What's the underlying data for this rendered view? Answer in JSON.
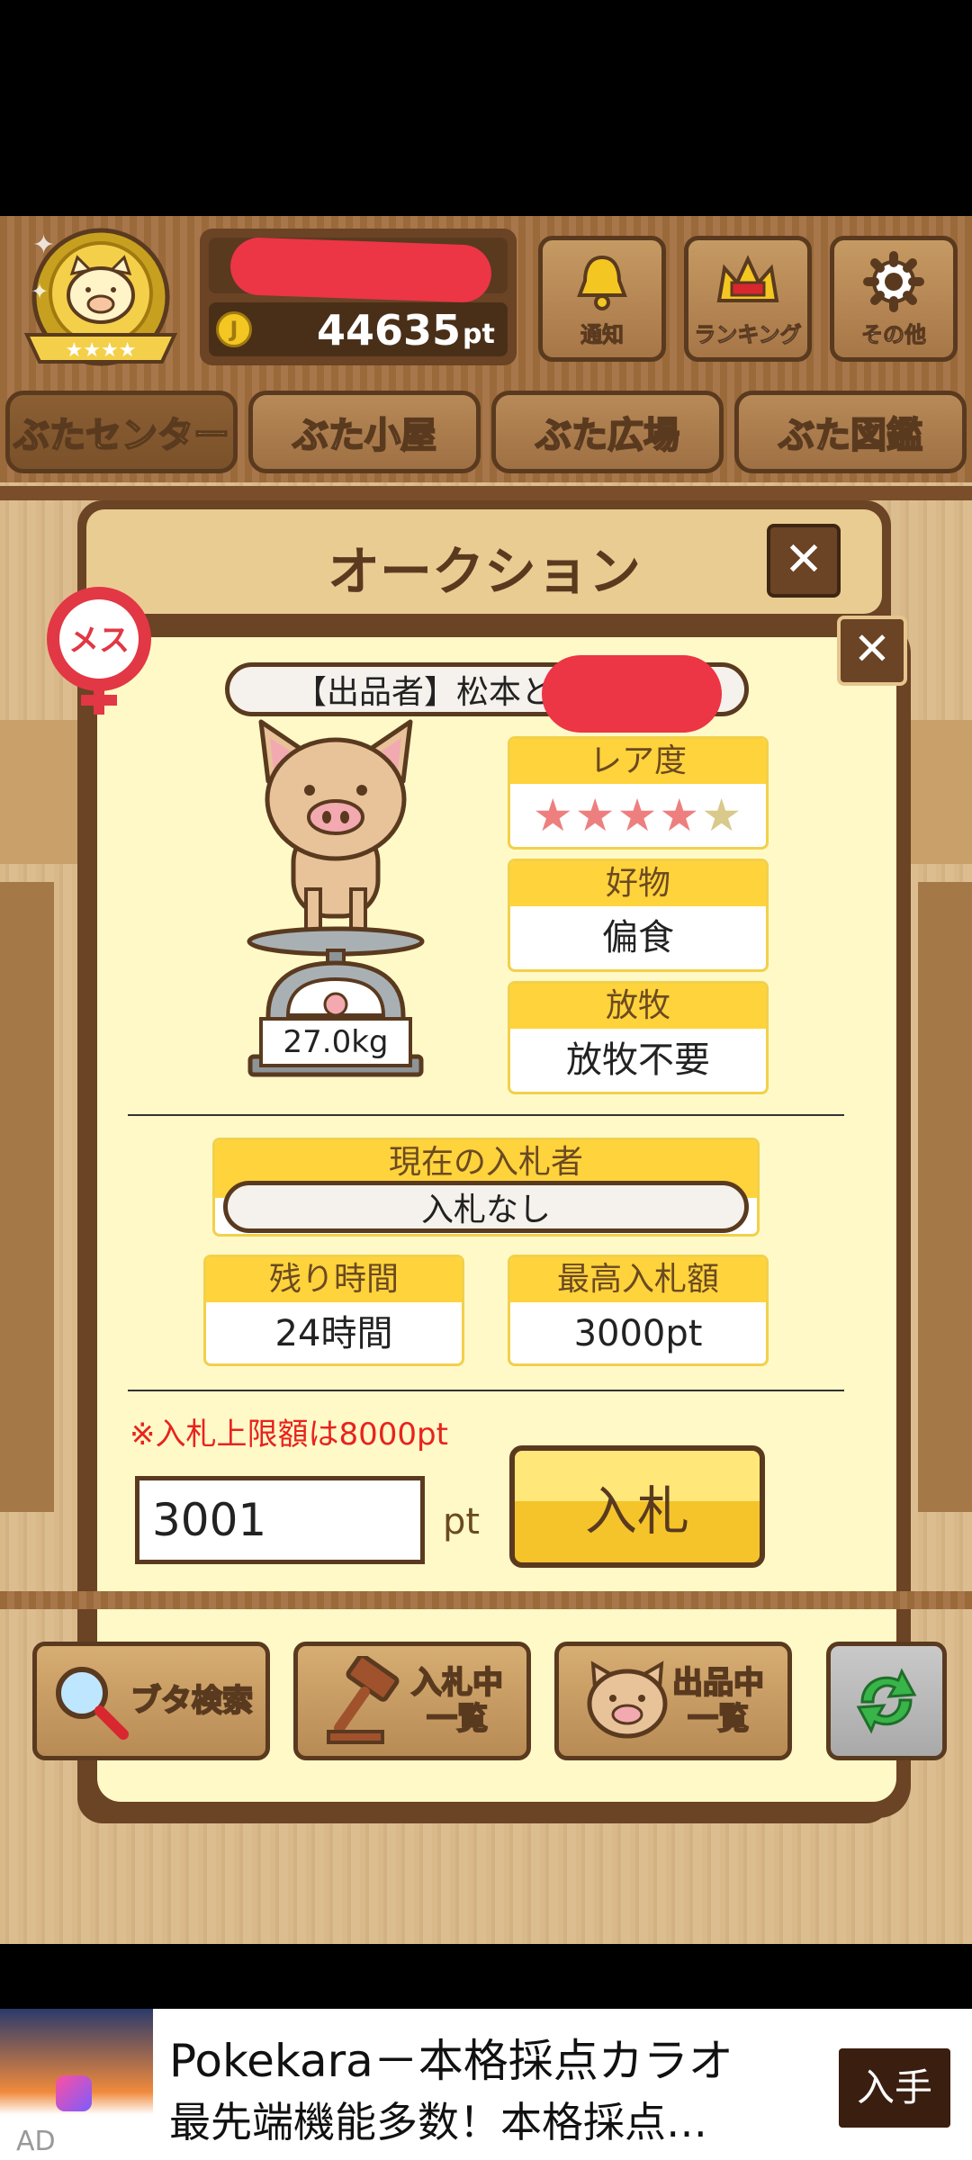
{
  "header": {
    "points": "44635",
    "points_unit": "pt",
    "buttons": [
      {
        "label": "通知",
        "icon": "bell-icon"
      },
      {
        "label": "ランキング",
        "icon": "crown-icon"
      },
      {
        "label": "その他",
        "icon": "gear-icon"
      }
    ]
  },
  "tabs": [
    {
      "label": "ぶたセンター",
      "active": true
    },
    {
      "label": "ぶた小屋",
      "active": false
    },
    {
      "label": "ぶた広場",
      "active": false
    },
    {
      "label": "ぶた図鑑",
      "active": false
    }
  ],
  "auction_window": {
    "title": "オークション",
    "close": "✕"
  },
  "detail": {
    "gender_badge": "メス",
    "close": "✕",
    "seller": "【出品者】松本と",
    "weight": "27.0kg",
    "rarity_label": "レア度",
    "rarity_stars": 4,
    "rarity_max": 5,
    "favorite_label": "好物",
    "favorite_value": "偏食",
    "grazing_label": "放牧",
    "grazing_value": "放牧不要",
    "current_bidder_label": "現在の入札者",
    "current_bidder_value": "入札なし",
    "remaining_label": "残り時間",
    "remaining_value": "24時間",
    "max_bid_label": "最高入札額",
    "max_bid_value": "3000pt",
    "limit_note": "※入札上限額は8000pt",
    "bid_input_value": "3001",
    "bid_unit": "pt",
    "bid_button": "入札"
  },
  "bottom_buttons": [
    {
      "label": "ブタ検索",
      "icon": "magnifier-icon"
    },
    {
      "label": "入札中\n一覧",
      "icon": "gavel-icon"
    },
    {
      "label": "出品中\n一覧",
      "icon": "pig-face-icon"
    },
    {
      "label": "",
      "icon": "refresh-icon"
    }
  ],
  "ad": {
    "title": "Pokekara－本格採点カラオ",
    "subtitle": "最先端機能多数！本格採点…",
    "cta": "入手",
    "badge": "AD"
  },
  "colors": {
    "accent_yellow": "#ffd33b",
    "brown_dark": "#5a3a1f",
    "limit_note_red": "#e8231d",
    "badge_red": "#e23744",
    "star_filled": "#ee7f7f",
    "star_empty": "#d9c98a"
  }
}
